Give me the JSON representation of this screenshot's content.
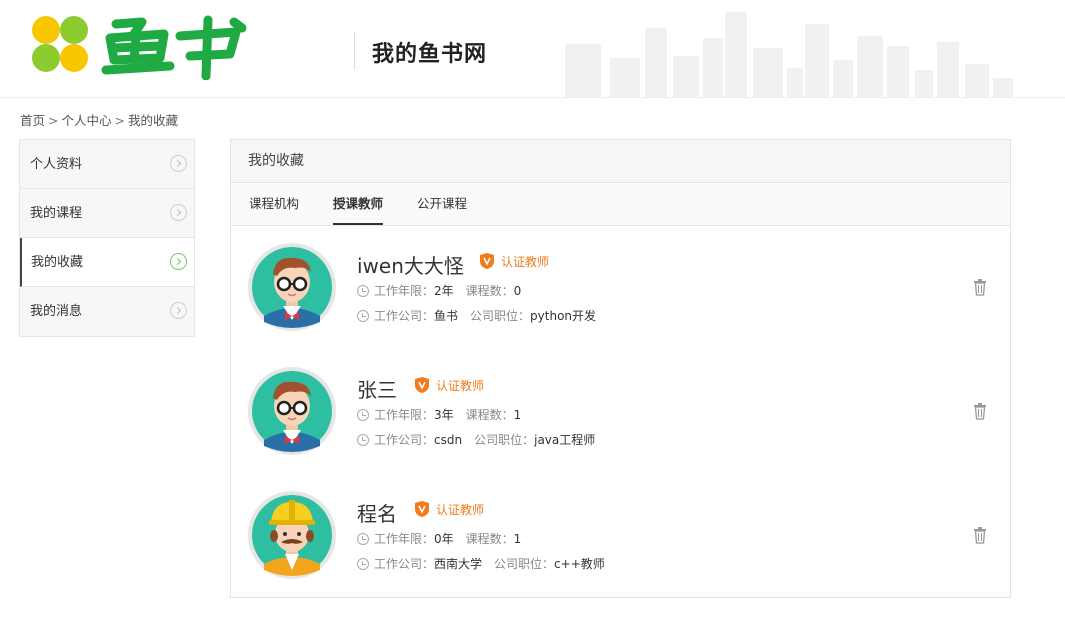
{
  "header": {
    "logo_text": "鱼书",
    "site_title": "我的鱼书网"
  },
  "breadcrumb": {
    "items": [
      "首页",
      "个人中心",
      "我的收藏"
    ],
    "separator": ">"
  },
  "sidebar": {
    "items": [
      {
        "label": "个人资料"
      },
      {
        "label": "我的课程"
      },
      {
        "label": "我的收藏"
      },
      {
        "label": "我的消息"
      }
    ],
    "active_label": "我的收藏"
  },
  "panel": {
    "title": "我的收藏",
    "tabs": [
      {
        "label": "课程机构"
      },
      {
        "label": "授课教师"
      },
      {
        "label": "公开课程"
      }
    ],
    "active_tab": "授课教师"
  },
  "labels": {
    "badge": "认证教师",
    "work_years": "工作年限：",
    "course_count": "课程数：",
    "company": "工作公司：",
    "position": "公司职位："
  },
  "teachers": [
    {
      "name": "iwen大大怪",
      "work_years": "2年",
      "course_count": "0",
      "company": "鱼书",
      "position": "python开发",
      "avatar": "nerd-avatar-icon"
    },
    {
      "name": "张三",
      "work_years": "3年",
      "course_count": "1",
      "company": "csdn",
      "position": "java工程师",
      "avatar": "nerd-avatar-icon"
    },
    {
      "name": "程名",
      "work_years": "0年",
      "course_count": "1",
      "company": "西南大学",
      "position": "c++教师",
      "avatar": "worker-avatar-icon"
    }
  ],
  "colors": {
    "brand_green": "#1faa44",
    "logo_yellow": "#f7c600",
    "logo_lime": "#8ccc2f",
    "badge_orange": "#f07c1e",
    "avatar_teal": "#2ebfa3"
  }
}
